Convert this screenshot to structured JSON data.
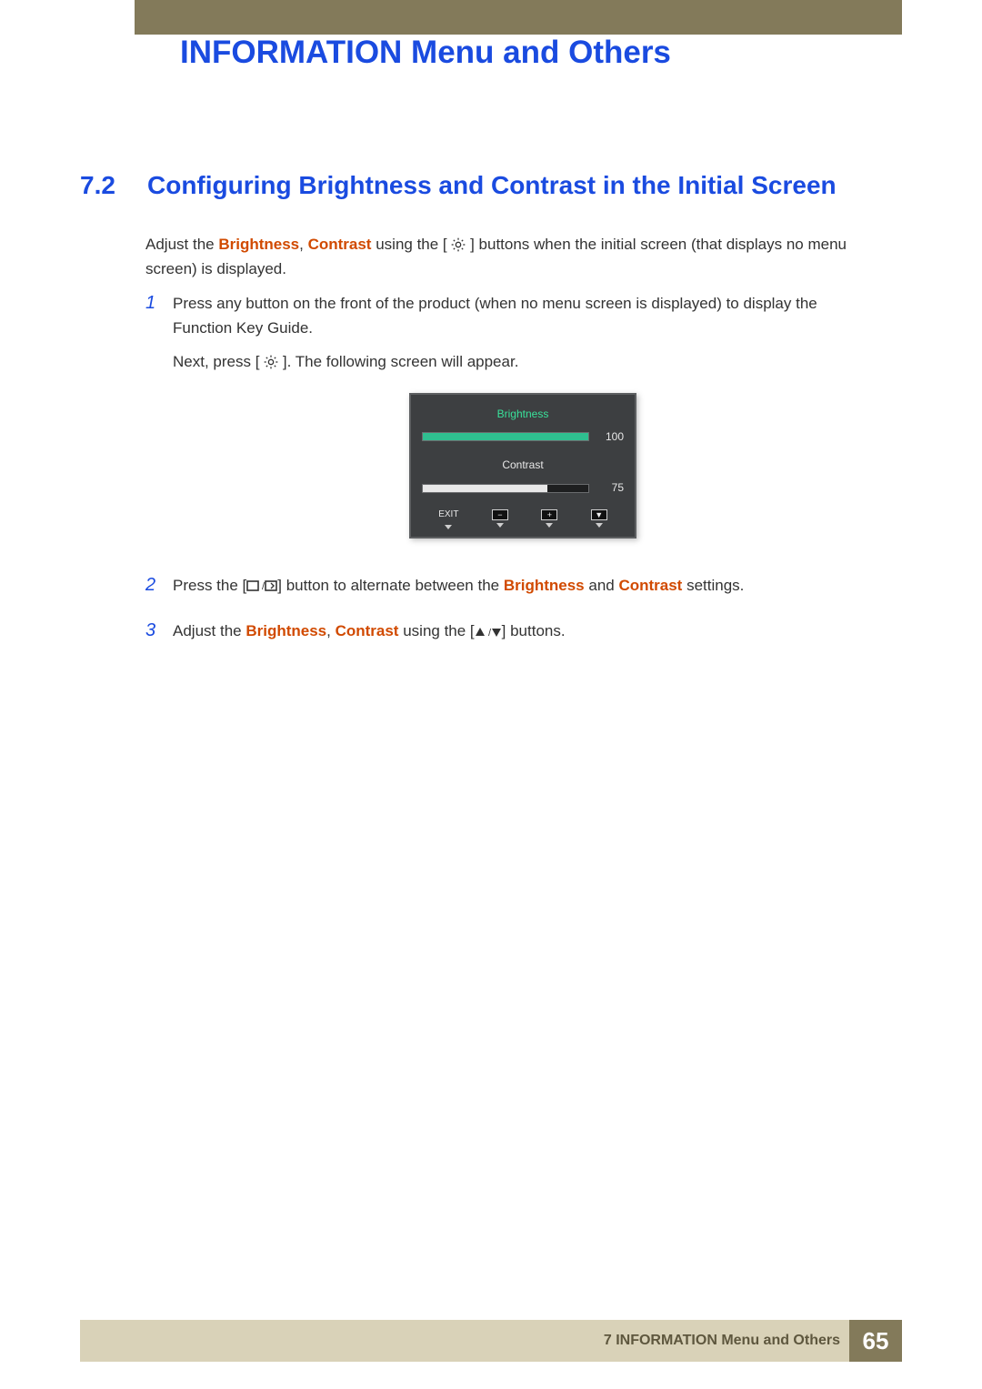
{
  "header": {
    "chapter_title": "INFORMATION Menu and Others"
  },
  "section": {
    "number": "7.2",
    "title": "Configuring Brightness and Contrast in the Initial Screen"
  },
  "intro": {
    "pre": "Adjust the ",
    "kw1": "Brightness",
    "sep": ", ",
    "kw2": "Contrast",
    "mid": " using the [ ",
    "post": " ] buttons when the initial screen (that displays no menu screen) is displayed."
  },
  "steps": {
    "s1": {
      "num": "1",
      "line1": "Press any button on the front of the product (when no menu screen is displayed) to display the Function Key Guide.",
      "line2_pre": "Next, press [ ",
      "line2_post": " ]. The following screen will appear."
    },
    "s2": {
      "num": "2",
      "pre": "Press the [",
      "mid1": "] button to alternate between the ",
      "kw1": "Brightness",
      "and": " and ",
      "kw2": "Contrast",
      "post": " settings."
    },
    "s3": {
      "num": "3",
      "pre": "Adjust the ",
      "kw1": "Brightness",
      "sep": ", ",
      "kw2": "Contrast",
      "mid": " using the [",
      "post": "] buttons."
    }
  },
  "osd": {
    "brightness_label": "Brightness",
    "brightness_value": "100",
    "contrast_label": "Contrast",
    "contrast_value": "75",
    "exit_label": "EXIT",
    "minus": "−",
    "plus": "+",
    "down": "▼"
  },
  "footer": {
    "text": "7 INFORMATION Menu and Others",
    "page": "65"
  }
}
